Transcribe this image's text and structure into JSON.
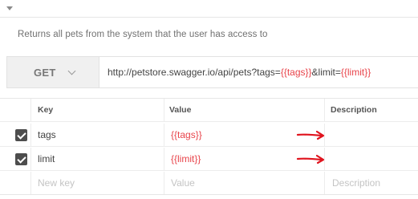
{
  "request": {
    "description": "Returns all pets from the system that the user has access to",
    "method": "GET",
    "url": {
      "base": "http://petstore.swagger.io/api/pets?tags=",
      "var1": "{{tags}}",
      "mid": "&limit=",
      "var2": "{{limit}}"
    }
  },
  "params": {
    "headers": {
      "key": "Key",
      "value": "Value",
      "description": "Description"
    },
    "rows": [
      {
        "key": "tags",
        "value": "{{tags}}",
        "checked": true
      },
      {
        "key": "limit",
        "value": "{{limit}}",
        "checked": true
      }
    ],
    "new_row": {
      "key_placeholder": "New key",
      "value_placeholder": "Value",
      "description_placeholder": "Description"
    }
  },
  "colors": {
    "variable": "#e8434a",
    "annotation_arrow": "#e0141e",
    "checkbox": "#4d4d4d"
  }
}
